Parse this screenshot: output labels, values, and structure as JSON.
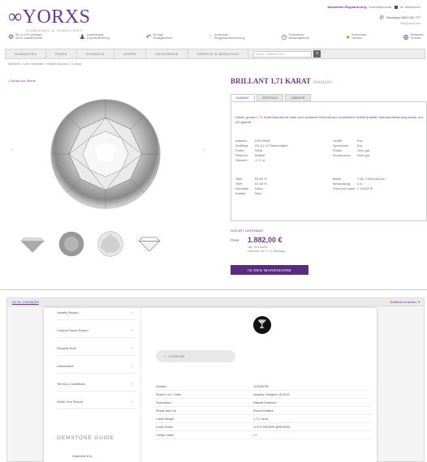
{
  "brand": {
    "logo_text": "YORXS",
    "logo_mark": "∞",
    "logo_sub": "DIAMONDS & JEWELLERY"
  },
  "toplinks": {
    "a": "Newsletter-Registrierung",
    "b": "Kontaktformular",
    "c": "Ihr Warenkorb"
  },
  "phone": {
    "icon": "phone-icon",
    "text": "Beratung 0800 000 777",
    "sub": "info@yorxs.com"
  },
  "features": [
    {
      "icon": "gear-icon",
      "l1": "Bis zu 10% günstiger",
      "l2": "als im Juwelierhandel"
    },
    {
      "icon": "user-icon",
      "l1": "Unabhängige",
      "l2": "Expertenberatung"
    },
    {
      "icon": "return-icon",
      "l1": "30 Tage",
      "l2": "Rückgaberecht"
    },
    {
      "icon": "ring-icon",
      "l1": "Kostenlose",
      "l2": "Ringgrößenbestimmung"
    },
    {
      "icon": "clock-icon",
      "l1": "Persönlicher",
      "l2": "Beratungstermin"
    },
    {
      "icon": "coin-icon",
      "l1": "Kostenloser",
      "l2": "Versand"
    },
    {
      "icon": "globe-icon",
      "l1": "Weltweiter",
      "l2": "Versand"
    }
  ],
  "nav": {
    "items": [
      "Diamanten",
      "Ringe",
      "Schmuck",
      "Uhren",
      "Geschenke",
      "Service & Beratung"
    ],
    "search_placeholder": "Suche - Artikelnr. oder ...",
    "search_icon": "search-icon"
  },
  "breadcrumb": "Startseite > Lose Diamanten > Brillant Diamant 1,71 Karat",
  "back_link": "‹ Zurück zur Suche",
  "product": {
    "title": "BRILLANT 1,71 KARAT",
    "title_sub": "DIAMANT",
    "tabs": [
      "Diamant",
      "Zertifikat",
      "Zubehör"
    ],
    "description": "Dieser grosse 1,71 Karat Diamant ist einer sehr sauberen Reinheit und exzellenten Schliff-Qualität. Diamant Bewertung wurde von IGI geprüft.",
    "spec_left": [
      [
        "Artikelnr.",
        "D0479935"
      ],
      [
        "Zertifikat",
        "IGI (L) 12 Rechnungen"
      ],
      [
        "Farbe",
        "Weiß"
      ],
      [
        "Reinheit",
        "Brillant"
      ],
      [
        "Gewicht",
        "1,71 ct"
      ]
    ],
    "spec_right": [
      [
        "Schliff",
        "Exc"
      ],
      [
        "Symmetrie",
        "Exc"
      ],
      [
        "Politur",
        "Sehr gut"
      ],
      [
        "Fluoreszenz",
        "Sehr gut"
      ]
    ],
    "spec_left2": [
      [
        "Tafel",
        "60,50 %"
      ],
      [
        "Tiefe",
        "61,50 %"
      ],
      [
        "Rundiste",
        "Dünn"
      ],
      [
        "Kalette",
        "Nein"
      ]
    ],
    "spec_right2": [
      [
        "Maße",
        "7,60-7,63x4,68 mm"
      ],
      [
        "Behandlung",
        "n.a."
      ],
      [
        "Preis pro Karat",
        "1.100,00 €"
      ]
    ],
    "availability": "Sofort lieferbar",
    "price_label": "Preis:",
    "price": "1.882,00 €",
    "vat": "inkl. 19% MwSt.",
    "shipping": "Lieferzeit: ca. 3 - 12 Werktage",
    "cart_button": "In den Warenkorb"
  },
  "certificate": {
    "bar_left": "IGI Nr. 123456789",
    "bar_right": "Zertifikat schließen ✕",
    "menu": [
      "Jewelry Report",
      "Colored Stone Report",
      "Security Seal",
      "Laserscribe",
      "Terms & Conditions",
      "Verify Your Report"
    ],
    "guide_title": "GEMSTONE GUIDE",
    "guide_item": "Diamond 4Cs",
    "search_pill": "123456789",
    "rows": [
      [
        "Number",
        "123456789"
      ],
      [
        "Report Loc + Date",
        "Antwerp, Belgium 18.2013"
      ],
      [
        "Description",
        "Natural Diamond"
      ],
      [
        "Shape and Cut",
        "Round Brilliant"
      ],
      [
        "Carat Weight",
        "1.71 Carat"
      ],
      [
        "Color Grade",
        "LIGHT BROWN (BROWN)"
      ],
      [
        "Clarity Grade",
        "I 1"
      ]
    ]
  }
}
